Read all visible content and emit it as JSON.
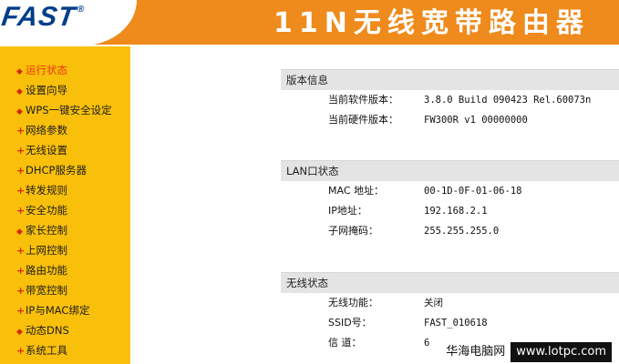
{
  "header": {
    "logo_text": "FAST",
    "logo_mark": "®",
    "title": "11N无线宽带路由器"
  },
  "sidebar": {
    "items": [
      {
        "label": "运行状态",
        "marker": "bullet",
        "active": true
      },
      {
        "label": "设置向导",
        "marker": "bullet",
        "active": false
      },
      {
        "label": "WPS一键安全设定",
        "marker": "bullet",
        "active": false
      },
      {
        "label": "网络参数",
        "marker": "plus",
        "active": false
      },
      {
        "label": "无线设置",
        "marker": "plus",
        "active": false
      },
      {
        "label": "DHCP服务器",
        "marker": "plus",
        "active": false
      },
      {
        "label": "转发规则",
        "marker": "plus",
        "active": false
      },
      {
        "label": "安全功能",
        "marker": "plus",
        "active": false
      },
      {
        "label": "家长控制",
        "marker": "bullet",
        "active": false
      },
      {
        "label": "上网控制",
        "marker": "plus",
        "active": false
      },
      {
        "label": "路由功能",
        "marker": "plus",
        "active": false
      },
      {
        "label": "带宽控制",
        "marker": "plus",
        "active": false
      },
      {
        "label": "IP与MAC绑定",
        "marker": "plus",
        "active": false
      },
      {
        "label": "动态DNS",
        "marker": "bullet",
        "active": false
      },
      {
        "label": "系统工具",
        "marker": "plus",
        "active": false
      }
    ]
  },
  "version_info": {
    "heading": "版本信息",
    "rows": [
      {
        "label": "当前软件版本：",
        "value": "3.8.0 Build 090423 Rel.60073n"
      },
      {
        "label": "当前硬件版本：",
        "value": "FW300R v1 00000000"
      }
    ]
  },
  "lan_status": {
    "heading": "LAN口状态",
    "rows": [
      {
        "label": "MAC 地址：",
        "value": "00-1D-0F-01-06-18"
      },
      {
        "label": "IP地址：",
        "value": "192.168.2.1"
      },
      {
        "label": "子网掩码：",
        "value": "255.255.255.0"
      }
    ]
  },
  "wireless_status": {
    "heading": "无线状态",
    "rows": [
      {
        "label": "无线功能：",
        "value": "关闭"
      },
      {
        "label": "SSID号：",
        "value": "FAST_010618"
      },
      {
        "label": "信 道：",
        "value": "6"
      }
    ]
  },
  "watermark": {
    "site_name": "华海电脑网",
    "domain": "www.lotpc.com"
  },
  "colors": {
    "header_orange": "#ef8a1c",
    "sidebar_yellow": "#f9c00b",
    "logo_blue": "#003e8a",
    "active_red": "#e8340d"
  }
}
